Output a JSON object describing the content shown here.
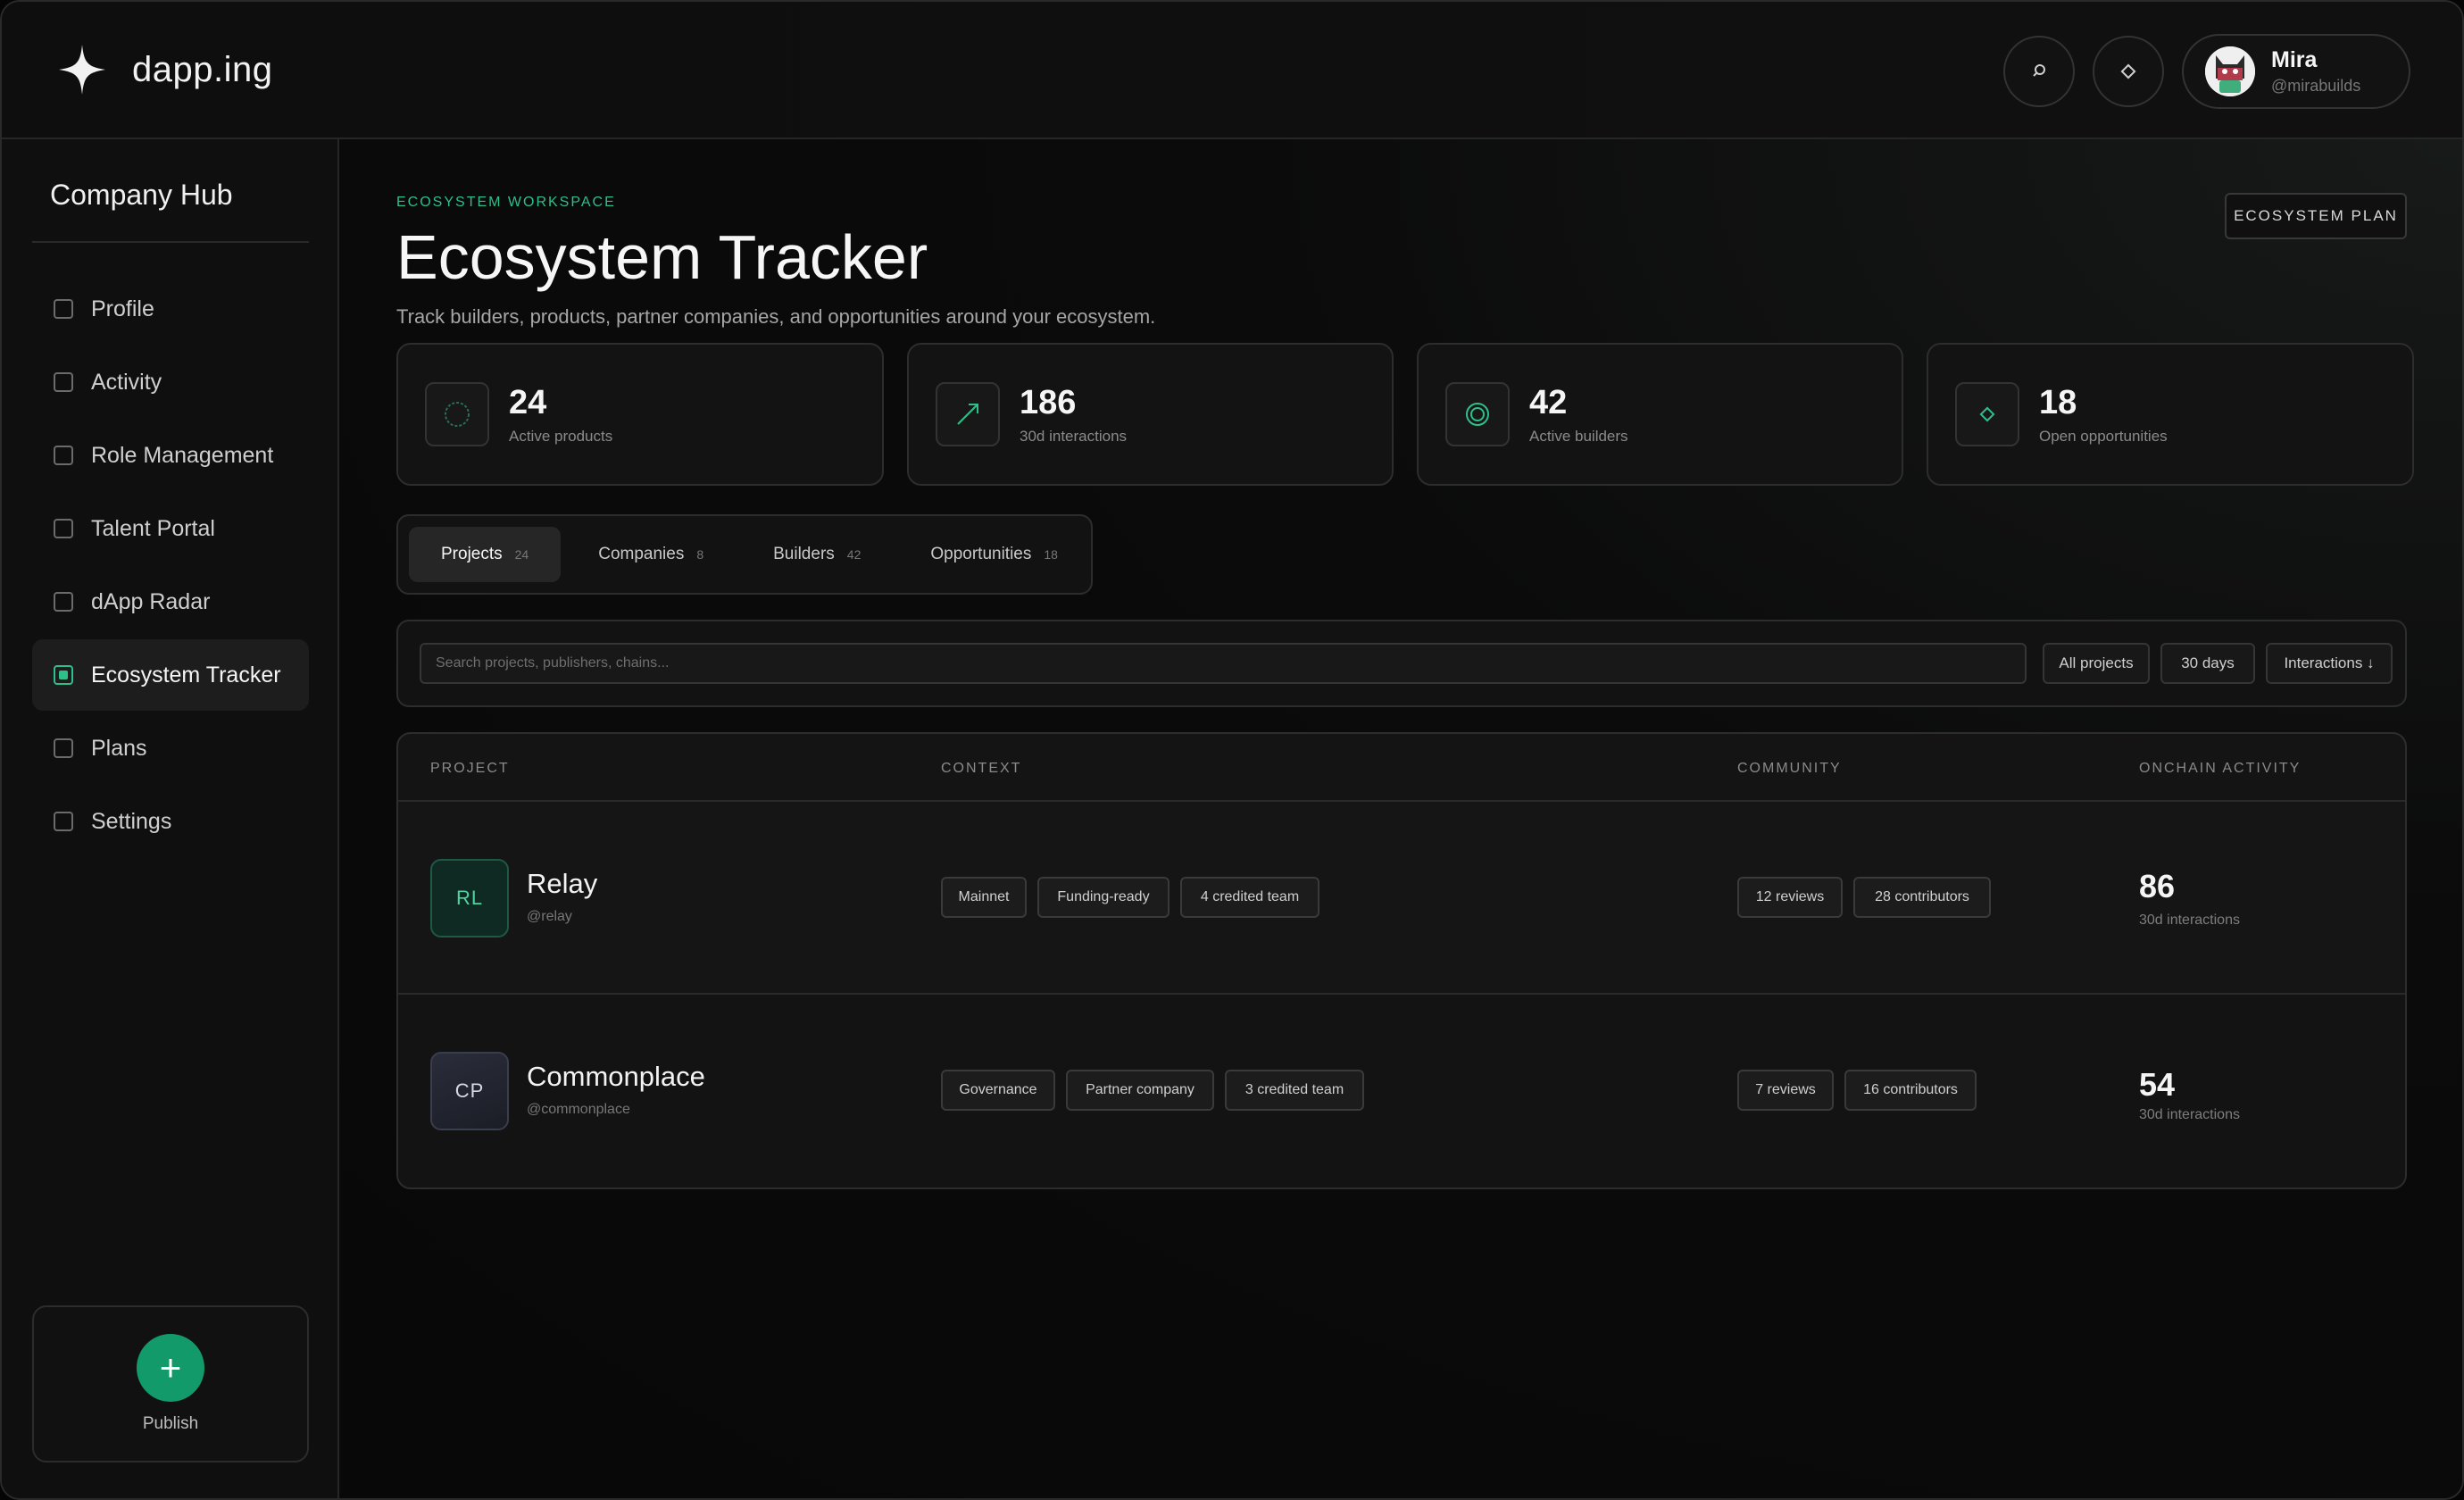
{
  "app": {
    "name": "dapp.ing"
  },
  "user": {
    "name": "Mira",
    "handle": "@mirabuilds"
  },
  "sidebar": {
    "title": "Company Hub",
    "items": [
      {
        "label": "Profile",
        "active": false
      },
      {
        "label": "Activity",
        "active": false
      },
      {
        "label": "Role Management",
        "active": false
      },
      {
        "label": "Talent Portal",
        "active": false
      },
      {
        "label": "dApp Radar",
        "active": false
      },
      {
        "label": "Ecosystem Tracker",
        "active": true
      },
      {
        "label": "Plans",
        "active": false
      },
      {
        "label": "Settings",
        "active": false
      }
    ],
    "publish_label": "Publish"
  },
  "header": {
    "eyebrow": "ECOSYSTEM WORKSPACE",
    "title": "Ecosystem Tracker",
    "subtitle": "Track builders, products, partner companies, and opportunities around your ecosystem.",
    "plan_button": "ECOSYSTEM PLAN"
  },
  "stats": [
    {
      "value": "24",
      "label": "Active products",
      "icon": "circle-dashed-icon"
    },
    {
      "value": "186",
      "label": "30d interactions",
      "icon": "trend-arrow-icon"
    },
    {
      "value": "42",
      "label": "Active builders",
      "icon": "target-icon"
    },
    {
      "value": "18",
      "label": "Open opportunities",
      "icon": "diamond-icon"
    }
  ],
  "tabs": [
    {
      "label": "Projects",
      "count": "24",
      "active": true
    },
    {
      "label": "Companies",
      "count": "8",
      "active": false
    },
    {
      "label": "Builders",
      "count": "42",
      "active": false
    },
    {
      "label": "Opportunities",
      "count": "18",
      "active": false
    }
  ],
  "filters": {
    "search_placeholder": "Search projects, publishers, chains...",
    "scope": "All projects",
    "range": "30 days",
    "sort": "Interactions ↓"
  },
  "table": {
    "columns": [
      "PROJECT",
      "CONTEXT",
      "COMMUNITY",
      "ONCHAIN ACTIVITY"
    ],
    "rows": [
      {
        "initials": "RL",
        "name": "Relay",
        "handle": "@relay",
        "context": [
          "Mainnet",
          "Funding-ready",
          "4 credited team"
        ],
        "community": [
          "12 reviews",
          "28 contributors"
        ],
        "activity_value": "86",
        "activity_label": "30d interactions"
      },
      {
        "initials": "CP",
        "name": "Commonplace",
        "handle": "@commonplace",
        "context": [
          "Governance",
          "Partner company",
          "3 credited team"
        ],
        "community": [
          "7 reviews",
          "16 contributors"
        ],
        "activity_value": "54",
        "activity_label": "30d interactions"
      }
    ]
  },
  "colors": {
    "accent": "#2fbf8a",
    "publish": "#139a6a",
    "background": "#0a0a0a"
  }
}
